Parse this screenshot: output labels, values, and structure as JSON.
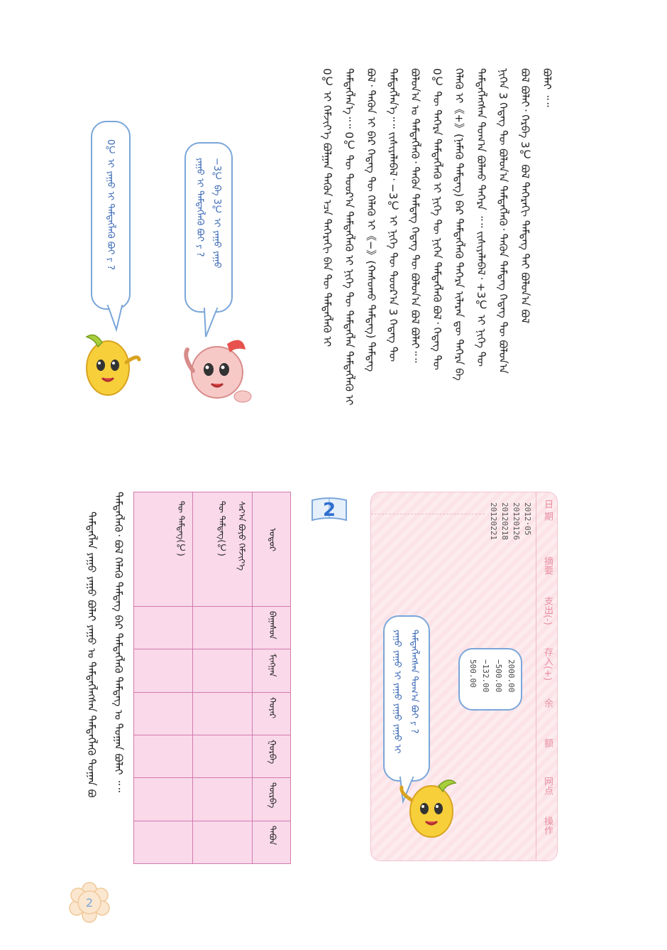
{
  "paragraph": {
    "lines": [
      "ᠪᠣᠯᠠᠢ ᠃᠃",
      "ᠪᠣᠯ ᠪᠣᠯᠠᠢ᠂ ᠬᠡᠷᠪᠡ 3℃ ᠪᠣᠯ ᠳᠡᠭᠡᠷᠡᠬᠢ ᠲᠡᠮᠳᠡᠭ ᠲᠡᠢ ᠪᠣᠯᠣᠨ᠎ᠠ ᠪᠣᠯ",
      "ᠨᠢᠭᠡᠨ 3 ᠭᠡᠳᠡᠭ ᠲᠦ ᠪᠣᠯᠣᠨ᠎ᠠ ᠲᠡᠮᠳᠡᠭᠯᠡᠬᠦ᠂ ᠲᠡᠭᠦᠨ ᠲᠡᠮᠳᠡᠭ ᠭᠡᠳᠡᠭ ᠲᠦ ᠪᠣᠯᠣᠨ᠎ᠠ",
      "ᠲᠡᠮᠳᠡᠭᠯᠡᠭᠰᠡᠨ ᠲᠣᠭ᠎ᠠ ᠪᠣᠯᠬᠤ ᠳᠡᠭᠡᠷᠡ ᠃᠃ ᠵᠢᠱᠢᠶᠡᠯᠡᠪᠡᠯ᠂ +3℃ ᠢ ᠨᠢᠭᠡ ᠲᠦ",
      "ᠬᠡᠯᠡᠬᠦ ᠢ《+》(ᠨᠡᠮᠡᠬᠦ ᠲᠡᠮᠳᠡᠭ) ᠪᠠᠷ ᠲᠡᠮᠳᠡᠭᠯᠡᠬᠦ ᠳᠡᠭᠡᠷᠡ ᠢᠯᠡᠷᠡᠨ ᠳᠦ ᠳᠡᠭᠡᠷᠡ ᠪᠡ",
      "0℃ ᠲᠦ ᠳᠡᠭᠡᠷᠡ ᠲᠡᠮᠳᠡᠭᠯᠡᠬᠦ ᠢ ᠨᠢᠭᠡ ᠲᠦ ᠨᠢᠭᠡᠨ ᠲᠡᠮᠳᠡᠭᠯᠡᠬᠦ ᠪᠣᠯ᠂ ᠭᠡᠳᠡᠭ ᠲᠦ",
      "ᠪᠣᠯᠣᠨ᠎ᠠ ᠤ ᠲᠡᠮᠳᠡᠭᠯᠡᠬᠦ᠂ ᠲᠡᠭᠦᠨ ᠲᠡᠮᠳᠡᠭ ᠭᠡᠳᠡᠭ ᠲᠦ ᠪᠣᠯᠣᠨ᠎ᠠ ᠪᠣᠯ ᠪᠣᠯᠠᠢ᠃᠃",
      "ᠲᠡᠮᠳᠡᠭᠯᠡᠨ᠎ᠡ᠃᠃ ᠵᠢᠱᠢᠶᠡᠯᠡᠪᠡᠯ᠂ −3℃ ᠢ ᠨᠢᠭᠡ ᠲᠦ ᠳᠣᠣᠷ᠎ᠠ 3 ᠭᠡᠳᠡᠭ ᠲᠦ",
      "ᠪᠣᠯ᠂ ᠲᠡᠭᠦᠨ ᠢ ᠪᠡᠷ ᠭᠡᠳᠡᠭ ᠲᠦ ᠬᠡᠯᠡᠬᠦ ᠢ《−》(ᠬᠠᠰᠤᠬᠤ ᠲᠡᠮᠳᠡᠭ) ᠲᠡᠮᠳᠡᠭ",
      "ᠲᠡᠮᠳᠡᠭᠯᠡᠨ᠎ᠡ᠃᠃ 0℃ ᠲᠦ ᠳᠣᠣᠷ᠎ᠠ ᠲᠡᠮᠳᠡᠭᠯᠡᠬᠦ ᠢ ᠨᠢᠭᠡ ᠲᠦ ᠲᠡᠮᠳᠡᠭᠯᠡᠨ ᠲᠡᠮᠳᠡᠭᠯᠡᠬᠦ ᠢ",
      "0℃ ᠢ ᠬᠡᠮᠵᠢᠶ᠎ᠡ ᠪᠣᠯᠭᠠᠨ ᠲᠡᠭᠦᠨ ᠡᠴᠡ ᠳᠡᠭᠡᠷᠡᠬᠢ ᠪᠠᠨ ᠲᠦ ᠲᠡᠮᠳᠡᠭᠯᠡᠬᠦ ᠢ"
    ]
  },
  "bubbles": {
    "right": [
      "0℃ ᠢ ᠶᠠᠭᠤ ᠢ ᠲᠡᠮᠳᠡᠭᠯᠡᠬᠦ ᠪᠤᠢ ᠶ ?"
    ],
    "left": [
      "ᠶᠠᠭᠤ ᠢ ᠲᠡᠮᠳᠡᠭᠯᠡᠬᠦ ᠪᠤᠢ ᠶ ?",
      "−3℃ ᠪᠠ 3℃ ᠢ ᠶᠠᠭᠤ ᠶᠠᠭᠤ"
    ],
    "passbook": [
      "ᠲᠡᠮᠳᠡᠭᠯᠡᠭᠰᠡᠨ ᠲᠣᠭ᠎ᠠ ᠪᠤᠢ ᠶ ?",
      "ᠶᠠᠭᠤ ᠶᠠᠭᠤ ᠢ ᠶᠠᠭᠤ ᠶᠠᠭᠤ ᠶᠠᠭᠤ ᠢ"
    ]
  },
  "passbook": {
    "headers": [
      "日 期",
      "摘要",
      "支出(-)",
      "存入(+)",
      "余",
      "额",
      "网点",
      "操作"
    ],
    "dates": [
      "2012·05",
      "20120126",
      "20120218",
      "20120221"
    ],
    "amounts": [
      "2000.00",
      "−500.00",
      "−132.00",
      "500.00"
    ]
  },
  "badge": {
    "number": "2"
  },
  "table": {
    "row_headers": [
      "ᠤᠳᠤᠷ",
      "ᠰᠠᠷ᠎ᠠ ᠪᠤᠶᠤ ᠬᠡᠮᠵᠢᠶ᠎ᠡ",
      "ᠲᠦ ᠲᠡᠮᠳᠡᠭ(℃)",
      "ᠲᠦ ᠲᠡᠮᠳᠡᠭ(℃)"
    ],
    "col_headers": [
      "ᠪᠠᠭᠠᠰᠤᠨ",
      "ᠮᠢᠩᠭᠠᠨ",
      "ᠬᠣᠶᠠᠷ",
      "ᠭᠤᠷᠪᠠ",
      "ᠳᠥᠷᠪᠡ",
      "ᠲᠠᠪᠤᠨ"
    ]
  },
  "bottom_text": {
    "lines": [
      "ᠲᠡᠮᠳᠡᠭᠯᠡᠬᠦ᠂ ᠪᠣᠯ ᠬᠡᠯᠡᠬᠦ ᠲᠡᠮᠳᠡᠭ ᠪᠡᠷ ᠲᠡᠮᠳᠡᠭᠯᠡᠬᠦ ᠲᠡᠮᠳᠡᠭ ᠤ ᠲᠣᠭᠠᠨ ᠪᠣᠯᠠᠢ ᠃᠃",
      "ᠲᠡᠮᠳᠡᠭᠯᠡᠨ ᠶᠠᠭᠤ ᠶᠠᠭᠤ ᠪᠣᠯᠠᠢ ᠶᠠᠭᠤ ᠤ ᠲᠡᠮᠳᠡᠭᠯᠡᠭᠰᠡᠨ ᠲᠡᠮᠳᠡᠭᠯᠡᠬᠦ ᠲᠣᠭᠠᠨ ᠪᠤ"
    ]
  },
  "page_number": "2",
  "colors": {
    "accent_blue": "#7aa6d9",
    "table_pink": "#f9d9ea",
    "table_border": "#d37ab0",
    "passbook_pink": "#fbe3e8",
    "badge_blue": "#2f6fcf"
  }
}
